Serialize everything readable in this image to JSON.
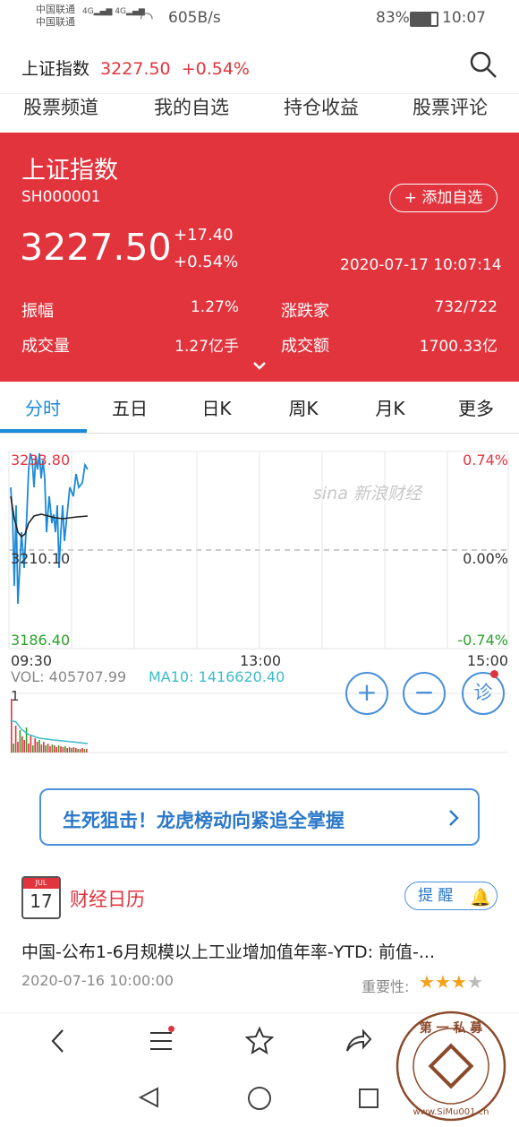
{
  "status_bar": {
    "carrier1": "中国联通",
    "carrier2": "中国联通",
    "net1": "4G",
    "net2": "4G",
    "speed": "605B/s",
    "battery": "83%",
    "time": "10:07"
  },
  "header": {
    "title": "上证指数",
    "price": "3227.50",
    "change_pct": "+0.54%"
  },
  "nav_tabs": [
    "股票频道",
    "我的自选",
    "持仓收益",
    "股票评论"
  ],
  "quote": {
    "name": "上证指数",
    "code": "SH000001",
    "add_watch_label": "+ 添加自选",
    "price": "3227.50",
    "change": "+17.40",
    "change_pct": "+0.54%",
    "datetime": "2020-07-17 10:07:14",
    "stats": [
      {
        "label": "振幅",
        "value": "1.27%"
      },
      {
        "label": "涨跌家",
        "value": "732/722"
      },
      {
        "label": "成交量",
        "value": "1.27亿手"
      },
      {
        "label": "成交额",
        "value": "1700.33亿"
      }
    ]
  },
  "chart_tabs": [
    "分时",
    "五日",
    "日K",
    "周K",
    "月K",
    "更多"
  ],
  "intraday": {
    "high_price": "3233.80",
    "mid_price": "3210.10",
    "low_price": "3186.40",
    "high_pct": "0.74%",
    "mid_pct": "0.00%",
    "low_pct": "-0.74%",
    "time_open": "09:30",
    "time_mid": "13:00",
    "time_close": "15:00",
    "watermark": "新浪财经",
    "vol_label": "VOL: 405707.99",
    "ma_label": "MA10: 1416620.40",
    "vol_axis": "1",
    "colors": {
      "up": "#e2343d",
      "down": "#2aa12a",
      "line": "#1c8ad8",
      "avg": "#222222",
      "ma": "#3dbcc8"
    }
  },
  "chart_buttons": {
    "zoom_in": "+",
    "zoom_out": "−",
    "diagnose": "诊"
  },
  "banner": {
    "text": "生死狙击！龙虎榜动向紧追全掌握"
  },
  "calendar": {
    "icon_month": "JUL",
    "icon_day": "17",
    "title": "财经日历",
    "remind_label": "提 醒",
    "headline": "中国-公布1-6月规模以上工业增加值年率-YTD: 前值-...",
    "date": "2020-07-16 10:00:00",
    "importance_label": "重要性:",
    "importance_stars": 3,
    "importance_max": 4
  },
  "watermark_stamp": {
    "top": "第 一 私 募",
    "bottom": "www.SiMu001.cn"
  }
}
